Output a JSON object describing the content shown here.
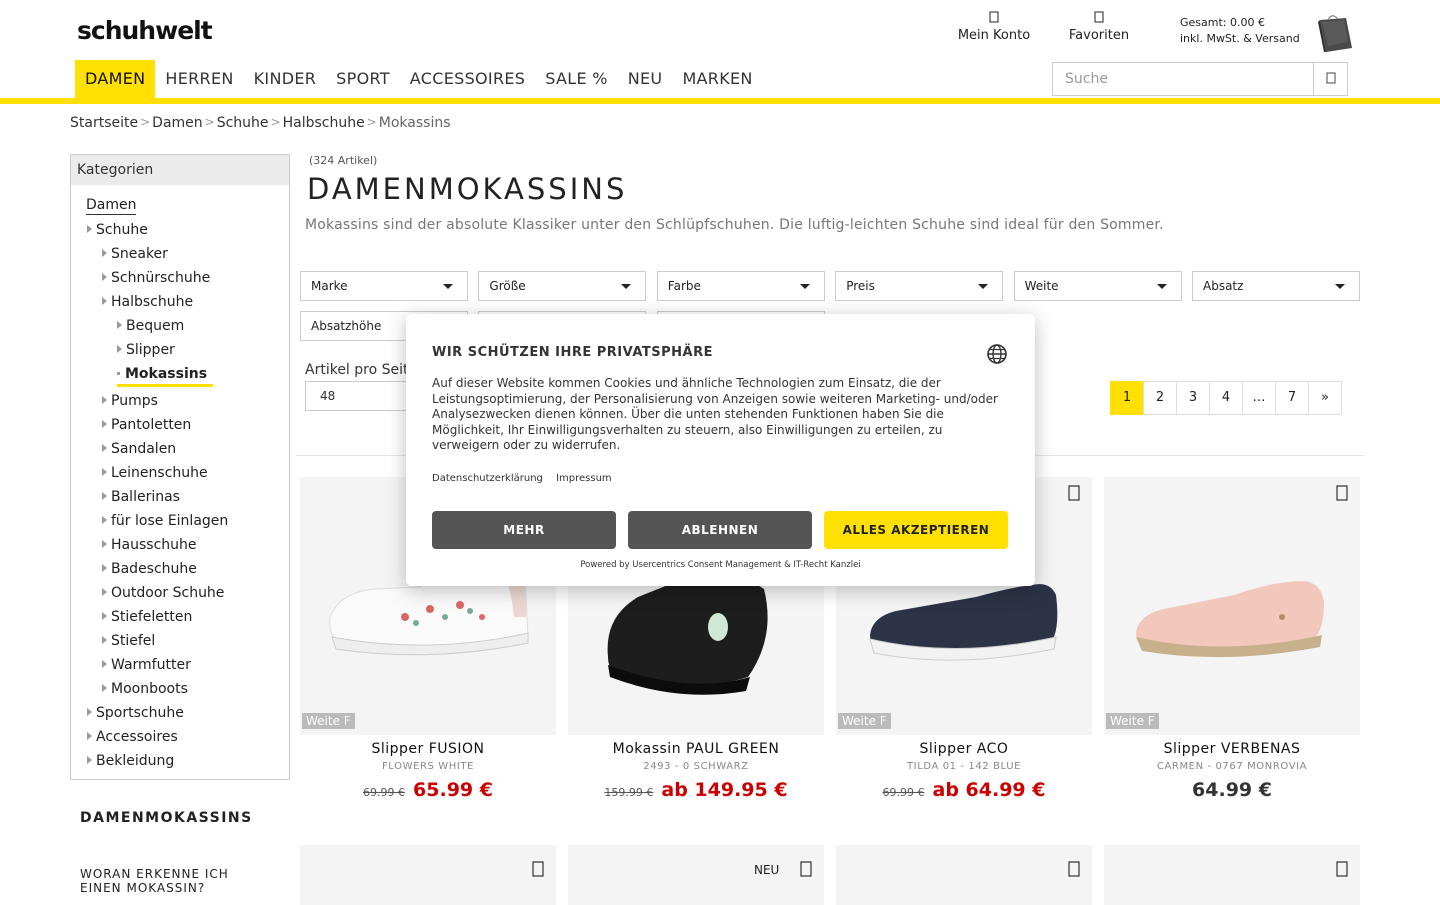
{
  "header": {
    "logo": "schuhwelt",
    "account_label": "Mein Konto",
    "favorites_label": "Favoriten",
    "cart_line1": "Gesamt: 0.00 €",
    "cart_line2": "inkl. MwSt. & Versand"
  },
  "nav": {
    "items": [
      {
        "label": "DAMEN",
        "active": true
      },
      {
        "label": "HERREN"
      },
      {
        "label": "KINDER"
      },
      {
        "label": "SPORT"
      },
      {
        "label": "ACCESSOIRES"
      },
      {
        "label": "SALE %"
      },
      {
        "label": "NEU"
      },
      {
        "label": "MARKEN"
      }
    ]
  },
  "search": {
    "placeholder": "Suche",
    "icon": "search-icon"
  },
  "breadcrumb": [
    "Startseite",
    "Damen",
    "Schuhe",
    "Halbschuhe",
    "Mokassins"
  ],
  "sidebar": {
    "heading": "Kategorien",
    "root": "Damen",
    "items": [
      {
        "label": "Schuhe",
        "level": 1
      },
      {
        "label": "Sneaker",
        "level": 2
      },
      {
        "label": "Schnürschuhe",
        "level": 2
      },
      {
        "label": "Halbschuhe",
        "level": 2
      },
      {
        "label": "Bequem",
        "level": 3
      },
      {
        "label": "Slipper",
        "level": 3
      },
      {
        "label": "Mokassins",
        "level": 3,
        "selected": true
      },
      {
        "label": "Pumps",
        "level": 2
      },
      {
        "label": "Pantoletten",
        "level": 2
      },
      {
        "label": "Sandalen",
        "level": 2
      },
      {
        "label": "Leinenschuhe",
        "level": 2
      },
      {
        "label": "Ballerinas",
        "level": 2
      },
      {
        "label": "für lose Einlagen",
        "level": 2
      },
      {
        "label": "Hausschuhe",
        "level": 2
      },
      {
        "label": "Badeschuhe",
        "level": 2
      },
      {
        "label": "Outdoor Schuhe",
        "level": 2
      },
      {
        "label": "Stiefeletten",
        "level": 2
      },
      {
        "label": "Stiefel",
        "level": 2
      },
      {
        "label": "Warmfutter",
        "level": 2
      },
      {
        "label": "Moonboots",
        "level": 2
      },
      {
        "label": "Sportschuhe",
        "level": 1
      },
      {
        "label": "Accessoires",
        "level": 1
      },
      {
        "label": "Bekleidung",
        "level": 1
      }
    ],
    "seo_title": "DAMENMOKASSINS",
    "seo_question": "WORAN ERKENNE ICH EINEN MOKASSIN?"
  },
  "main": {
    "count": "(324 Artikel)",
    "title": "DAMENMOKASSINS",
    "description": "Mokassins sind der absolute Klassiker unter den Schlüpfschuhen. Die luftig-leichten Schuhe sind ideal für den Sommer.",
    "filters": [
      "Marke",
      "Größe",
      "Farbe",
      "Preis",
      "Weite",
      "Absatz",
      "Absatzhöhe",
      "",
      ""
    ],
    "per_page_label": "Artikel pro Seite",
    "per_page_value": "48",
    "pagination": [
      "1",
      "2",
      "3",
      "4",
      "…",
      "7",
      "»"
    ]
  },
  "products": [
    {
      "name": "Slipper FUSION",
      "sub": "FLOWERS WHITE",
      "old_price": "69.99 €",
      "price": "65.99 €",
      "weite": "Weite F",
      "shoe": "white-sneaker"
    },
    {
      "name": "Mokassin PAUL GREEN",
      "sub": "2493 - 0 SCHWARZ",
      "old_price": "159.99 €",
      "price": "ab 149.95 €",
      "weite": "",
      "shoe": "black-loafer"
    },
    {
      "name": "Slipper ACO",
      "sub": "TILDA 01 - 142 BLUE",
      "old_price": "69.99 €",
      "price": "ab 64.99 €",
      "weite": "Weite F",
      "shoe": "navy-slipper"
    },
    {
      "name": "Slipper VERBENAS",
      "sub": "CARMEN - 0767 MONROVIA",
      "old_price": "",
      "price": "64.99 €",
      "weite": "Weite F",
      "shoe": "pink-espadrille"
    }
  ],
  "second_row": {
    "neu_label": "NEU"
  },
  "cookie": {
    "title": "WIR SCHÜTZEN IHRE PRIVATSPHÄRE",
    "text": "Auf dieser Website kommen Cookies und ähnliche Technologien zum Einsatz, die der Leistungsoptimierung, der Personalisierung von Anzeigen sowie weiteren Marketing- und/oder Analysezwecken dienen können. Über die unten stehenden Funktionen haben Sie die Möglichkeit, Ihr Einwilligungsverhalten zu steuern, also Einwilligungen zu erteilen, zu verweigern oder zu widerrufen.",
    "link_privacy": "Datenschutzerklärung",
    "link_imprint": "Impressum",
    "btn_more": "MEHR",
    "btn_decline": "ABLEHNEN",
    "btn_accept": "ALLES AKZEPTIEREN",
    "powered": "Powered by Usercentrics Consent Management & IT-Recht Kanzlei"
  },
  "colors": {
    "accent": "#ffe000",
    "sale": "#cc0000",
    "dark_button": "#555555"
  }
}
